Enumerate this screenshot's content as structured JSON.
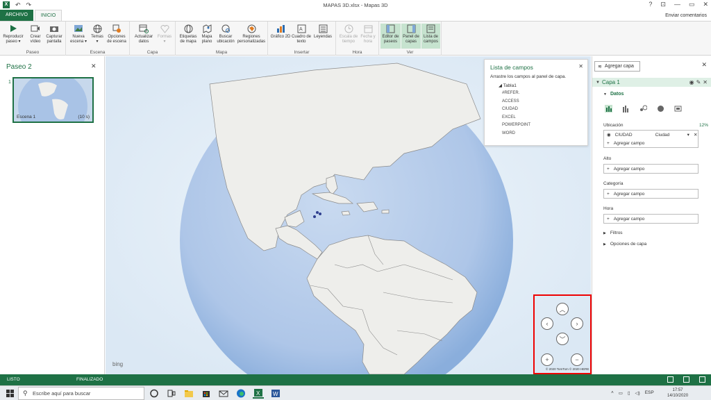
{
  "window": {
    "title": "MAPAS 3D.xlsx - Mapas 3D",
    "controls": [
      "?",
      "⊡",
      "—",
      "▭",
      "✕"
    ]
  },
  "tabs": {
    "file": "ARCHIVO",
    "home": "INICIO",
    "feedback": "Enviar comentarios"
  },
  "ribbon": {
    "groups": [
      {
        "label": "Paseo",
        "buttons": [
          {
            "label": "Reproducir paseo ▾",
            "icon": "play-icon"
          },
          {
            "label": "Crear vídeo",
            "icon": "video-icon"
          },
          {
            "label": "Capturar pantalla",
            "icon": "camera-icon"
          }
        ]
      },
      {
        "label": "Escena",
        "buttons": [
          {
            "label": "Nueva escena ▾",
            "icon": "new-scene-icon"
          },
          {
            "label": "Temas ▾",
            "icon": "globe-icon"
          },
          {
            "label": "Opciones de escena",
            "icon": "scene-options-icon"
          }
        ]
      },
      {
        "label": "Capa",
        "buttons": [
          {
            "label": "Actualizar datos",
            "icon": "refresh-icon"
          },
          {
            "label": "Formas ▾",
            "icon": "shapes-icon",
            "disabled": true
          }
        ]
      },
      {
        "label": "Mapa",
        "buttons": [
          {
            "label": "Etiquetas de mapa",
            "icon": "map-labels-icon"
          },
          {
            "label": "Mapa plano",
            "icon": "flat-map-icon"
          },
          {
            "label": "Buscar ubicación",
            "icon": "find-location-icon"
          },
          {
            "label": "Regiones personalizadas",
            "icon": "regions-icon"
          }
        ]
      },
      {
        "label": "Insertar",
        "buttons": [
          {
            "label": "Gráfico 2D",
            "icon": "chart-2d-icon"
          },
          {
            "label": "Cuadro de texto",
            "icon": "textbox-icon"
          },
          {
            "label": "Leyendas",
            "icon": "legend-icon"
          }
        ]
      },
      {
        "label": "Hora",
        "buttons": [
          {
            "label": "Escala de tiempo",
            "icon": "timeline-icon",
            "disabled": true
          },
          {
            "label": "Fecha y hora",
            "icon": "datetime-icon",
            "disabled": true
          }
        ]
      },
      {
        "label": "Ver",
        "buttons": [
          {
            "label": "Editor de paseos",
            "icon": "tour-editor-icon",
            "selected": true
          },
          {
            "label": "Panel de capas",
            "icon": "layer-pane-icon",
            "selected": true
          },
          {
            "label": "Lista de campos",
            "icon": "field-list-icon",
            "selected": true
          }
        ]
      }
    ]
  },
  "left_panel": {
    "title": "Paseo 2",
    "scene_number": "1",
    "scene_label": "Escena 1",
    "scene_duration": "(10 s)"
  },
  "field_list": {
    "title": "Lista de campos",
    "subtitle": "Arrastre los campos al panel de capa.",
    "table": "Tabla1",
    "fields": [
      "#REFER.",
      "ACCESS",
      "CIUDAD",
      "EXCEL",
      "POWERPOINT",
      "WORD"
    ]
  },
  "map": {
    "provider": "bing",
    "copyright": "© 2020 TomTom © 2020 HERE"
  },
  "right_panel": {
    "add_layer": "Agregar capa",
    "layer_name": "Capa 1",
    "data_header": "Datos",
    "location_label": "Ubicación",
    "location_pct": "12%",
    "location_field": "CIUDAD",
    "location_type": "Ciudad",
    "add_field": "Agregar campo",
    "height_label": "Alto",
    "category_label": "Categoría",
    "time_label": "Hora",
    "filters": "Filtros",
    "layer_options": "Opciones de capa"
  },
  "status": {
    "left": "LISTO",
    "center": "FINALIZADO"
  },
  "taskbar": {
    "search_placeholder": "Escribe aquí para buscar",
    "lang": "ESP",
    "time": "17:57",
    "date": "14/10/2020"
  },
  "colors": {
    "accent": "#1e7145",
    "ocean": "#b8cfe9",
    "land": "#eeeeeb",
    "highlight": "#e00000"
  }
}
